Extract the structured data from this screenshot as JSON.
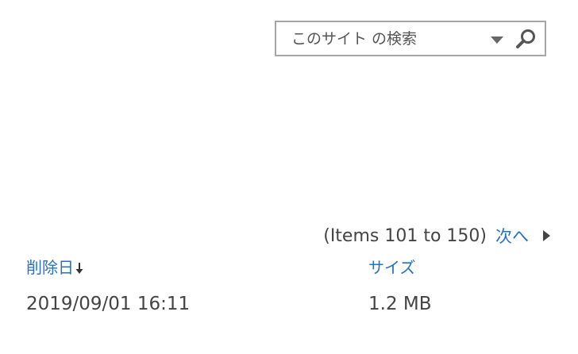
{
  "search": {
    "placeholder": "このサイト の検索",
    "scope_icon": "triangle-down-icon",
    "button_icon": "magnifier-icon"
  },
  "paging": {
    "range_text": "(Items 101 to 150)",
    "next_label": "次へ",
    "next_icon": "triangle-right-icon"
  },
  "table": {
    "columns": [
      {
        "label": "削除日",
        "sort": "descending"
      },
      {
        "label": "サイズ"
      }
    ],
    "rows": [
      {
        "deleted_date": "2019/09/01 16:11",
        "size": "1.2 MB"
      }
    ]
  },
  "colors": {
    "link": "#2672c0",
    "text": "#444444",
    "border": "#a6a6a6",
    "icon": "#555555"
  }
}
